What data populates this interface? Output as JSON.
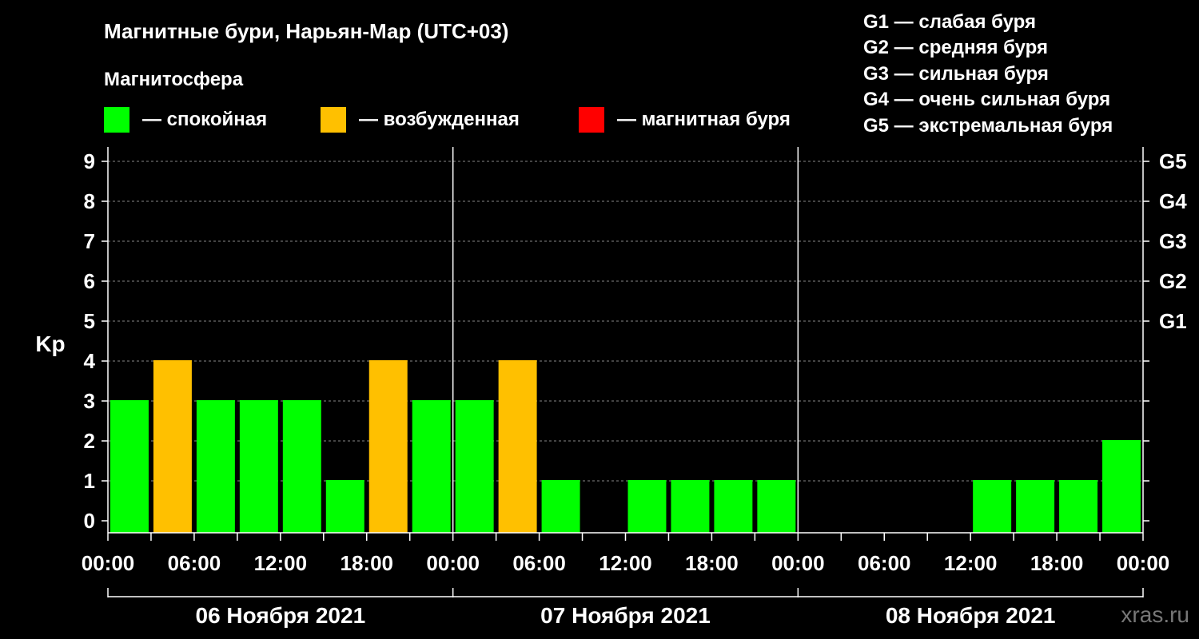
{
  "header": {
    "title": "Магнитные бури, Нарьян-Мар (UTC+03)",
    "subtitle": "Магнитосфера"
  },
  "legend": [
    {
      "label": "— спокойная",
      "color": "#00ff00"
    },
    {
      "label": "— возбужденная",
      "color": "#ffc000"
    },
    {
      "label": "— магнитная буря",
      "color": "#ff0000"
    }
  ],
  "storm_legend": [
    "G1 — слабая буря",
    "G2 — средняя буря",
    "G3 — сильная буря",
    "G4 — очень сильная буря",
    "G5 — экстремальная буря"
  ],
  "watermark": "xras.ru",
  "chart_data": {
    "type": "bar",
    "ylabel": "Kp",
    "ylim": [
      0,
      9
    ],
    "yticks": [
      0,
      1,
      2,
      3,
      4,
      5,
      6,
      7,
      8,
      9
    ],
    "right_ticks": [
      {
        "value": 5,
        "label": "G1"
      },
      {
        "value": 6,
        "label": "G2"
      },
      {
        "value": 7,
        "label": "G3"
      },
      {
        "value": 8,
        "label": "G4"
      },
      {
        "value": 9,
        "label": "G5"
      }
    ],
    "grid": true,
    "bar_interval_hours": 3,
    "x_ticks": [
      "00:00",
      "06:00",
      "12:00",
      "18:00",
      "00:00",
      "06:00",
      "12:00",
      "18:00",
      "00:00",
      "06:00",
      "12:00",
      "18:00",
      "00:00"
    ],
    "days": [
      "06 Ноября 2021",
      "07 Ноября 2021",
      "08 Ноября 2021"
    ],
    "status_colors": {
      "quiet": "#00ff00",
      "active": "#ffc000",
      "storm": "#ff0000"
    },
    "values": [
      3,
      4,
      3,
      3,
      3,
      1,
      4,
      3,
      3,
      4,
      1,
      0,
      1,
      1,
      1,
      1,
      0,
      0,
      0,
      0,
      1,
      1,
      1,
      2
    ],
    "status": [
      "quiet",
      "active",
      "quiet",
      "quiet",
      "quiet",
      "quiet",
      "active",
      "quiet",
      "quiet",
      "active",
      "quiet",
      "quiet",
      "quiet",
      "quiet",
      "quiet",
      "quiet",
      "quiet",
      "quiet",
      "quiet",
      "quiet",
      "quiet",
      "quiet",
      "quiet",
      "quiet"
    ]
  }
}
